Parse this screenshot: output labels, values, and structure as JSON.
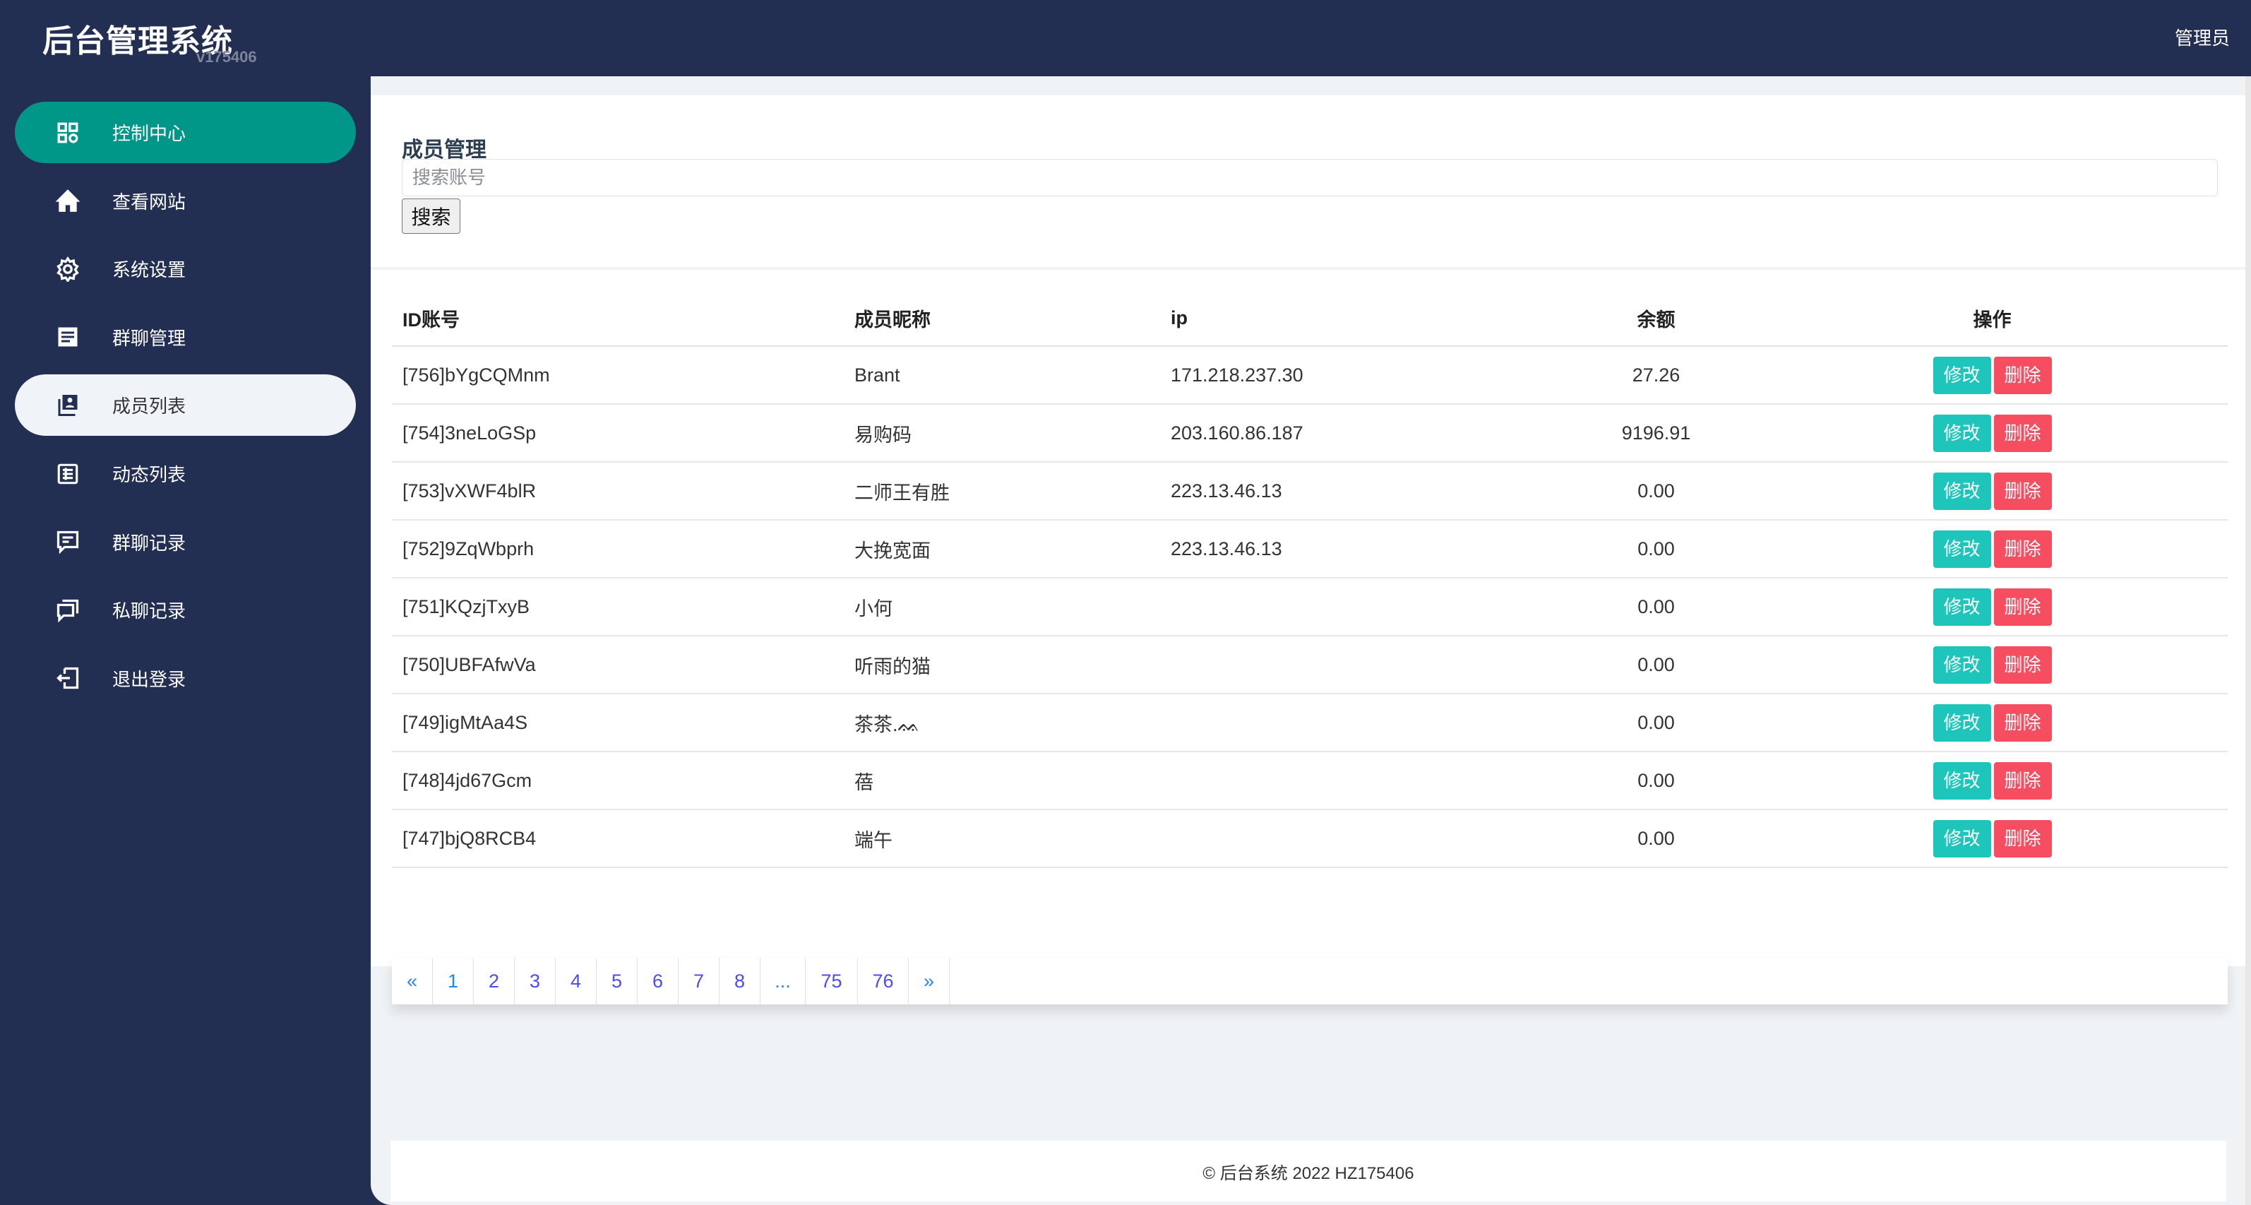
{
  "header": {
    "brand": "后台管理系统",
    "version": "v175406",
    "user": "管理员"
  },
  "sidebar": {
    "items": [
      {
        "label": "控制中心",
        "icon": "grid-icon"
      },
      {
        "label": "查看网站",
        "icon": "home-icon"
      },
      {
        "label": "系统设置",
        "icon": "gear-icon"
      },
      {
        "label": "群聊管理",
        "icon": "list-card-icon"
      },
      {
        "label": "成员列表",
        "icon": "contact-icon"
      },
      {
        "label": "动态列表",
        "icon": "table-icon"
      },
      {
        "label": "群聊记录",
        "icon": "chat-icon"
      },
      {
        "label": "私聊记录",
        "icon": "chats-icon"
      },
      {
        "label": "退出登录",
        "icon": "logout-icon"
      }
    ],
    "active_index": 4
  },
  "search": {
    "title": "成员管理",
    "placeholder": "搜索账号",
    "value": "",
    "button": "搜索"
  },
  "table": {
    "headers": [
      "ID账号",
      "成员昵称",
      "ip",
      "余额",
      "操作"
    ],
    "edit_label": "修改",
    "delete_label": "删除",
    "rows": [
      {
        "id": "[756]bYgCQMnm",
        "nick": "Brant",
        "ip": "171.218.237.30",
        "balance": "27.26"
      },
      {
        "id": "[754]3neLoGSp",
        "nick": "易购码",
        "ip": "203.160.86.187",
        "balance": "9196.91"
      },
      {
        "id": "[753]vXWF4blR",
        "nick": "二师王有胜",
        "ip": "223.13.46.13",
        "balance": "0.00"
      },
      {
        "id": "[752]9ZqWbprh",
        "nick": "大挽宽面",
        "ip": "223.13.46.13",
        "balance": "0.00"
      },
      {
        "id": "[751]KQzjTxyB",
        "nick": "小何",
        "ip": "",
        "balance": "0.00"
      },
      {
        "id": "[750]UBFAfwVa",
        "nick": "听雨的猫",
        "ip": "",
        "balance": "0.00"
      },
      {
        "id": "[749]igMtAa4S",
        "nick": "茶茶.ᨐ",
        "ip": "",
        "balance": "0.00"
      },
      {
        "id": "[748]4jd67Gcm",
        "nick": "蓓",
        "ip": "",
        "balance": "0.00"
      },
      {
        "id": "[747]bjQ8RCB4",
        "nick": "端午",
        "ip": "",
        "balance": "0.00"
      }
    ]
  },
  "pagination": [
    "«",
    "1",
    "2",
    "3",
    "4",
    "5",
    "6",
    "7",
    "8",
    "...",
    "75",
    "76",
    "»"
  ],
  "footer": "© 后台系统 2022 HZ175406"
}
